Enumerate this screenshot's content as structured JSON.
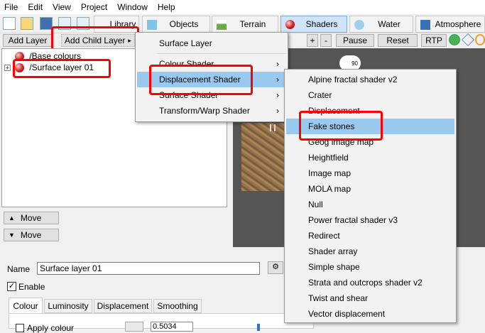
{
  "menubar": [
    "File",
    "Edit",
    "View",
    "Project",
    "Window",
    "Help"
  ],
  "toolbar": {
    "tabs": [
      {
        "label": "Library",
        "icon": "library-icon"
      },
      {
        "label": "Objects",
        "icon": "cube-icon"
      },
      {
        "label": "Terrain",
        "icon": "terrain-icon"
      },
      {
        "label": "Shaders",
        "icon": "sphere-icon"
      },
      {
        "label": "Water",
        "icon": "water-drop-icon"
      },
      {
        "label": "Atmosphere",
        "icon": "atmosphere-icon"
      }
    ],
    "active_tab": "Shaders"
  },
  "subtoolbar": {
    "add_layer": "Add Layer",
    "add_child_layer": "Add Child Layer",
    "plus": "+",
    "minus": "-",
    "pause": "Pause",
    "reset": "Reset",
    "rtp": "RTP"
  },
  "tree": {
    "items": [
      "/Base colours",
      "/Surface layer 01"
    ]
  },
  "move_buttons": [
    "Move",
    "Move"
  ],
  "lower": {
    "name_label": "Name",
    "name_value": "Surface layer 01",
    "enable_label": "Enable",
    "tabs": [
      "Colour",
      "Luminosity",
      "Displacement",
      "Smoothing"
    ],
    "apply_colour": "Apply colour",
    "value": "0.5034"
  },
  "menu1": {
    "items": [
      "Surface Layer",
      "Colour Shader",
      "Displacement Shader",
      "Surface Shader",
      "Transform/Warp Shader"
    ],
    "selected": "Displacement Shader"
  },
  "menu2": {
    "items": [
      "Alpine fractal shader v2",
      "Crater",
      "Displacement",
      "Fake stones",
      "Geog image map",
      "Heightfield",
      "Image map",
      "MOLA map",
      "Null",
      "Power fractal shader v3",
      "Redirect",
      "Shader array",
      "Simple shape",
      "Strata and outcrops shader v2",
      "Twist and shear",
      "Vector displacement"
    ],
    "selected": "Fake stones"
  },
  "viewport": {
    "badge": "90"
  },
  "colors": {
    "highlight": "#ff0000",
    "menu_selection": "#99c9ef",
    "active_tab": "#cfe4f8"
  }
}
